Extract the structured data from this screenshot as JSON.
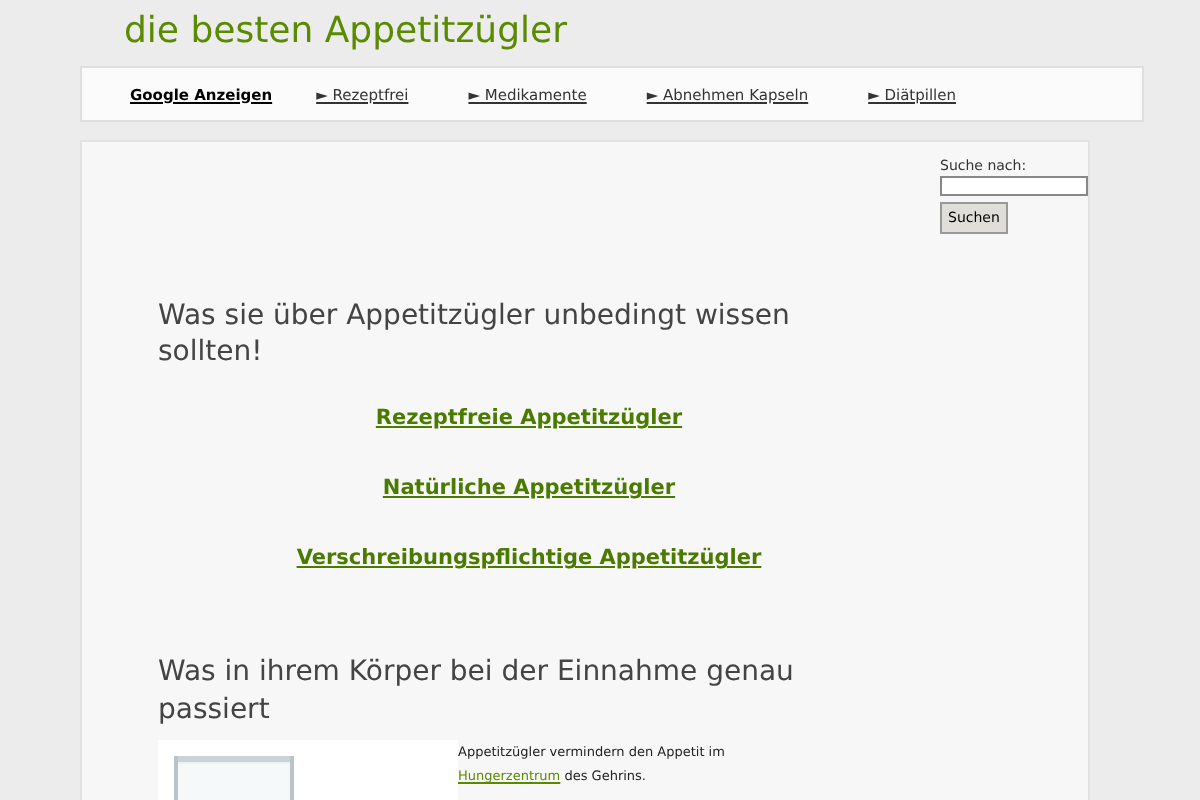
{
  "site_title": "die besten Appetitzügler",
  "nav": {
    "label": "Google Anzeigen",
    "links": [
      {
        "arrow": "►",
        "text": "Rezeptfrei"
      },
      {
        "arrow": "►",
        "text": "Medikamente"
      },
      {
        "arrow": "►",
        "text": "Abnehmen Kapseln"
      },
      {
        "arrow": "►",
        "text": "Diätpillen"
      }
    ]
  },
  "heading": "Was sie über Appetitzügler unbedingt wissen sollten!",
  "links": [
    "Rezeptfreie Appetitzügler",
    "Natürliche Appetitzügler",
    "Verschreibungspflichtige Appetitzügler"
  ],
  "section_heading": " Was in ihrem Körper bei der Einnahme genau passiert",
  "image": {
    "kind": "picture"
  },
  "paragraph": {
    "before": "Appetitzügler vermindern den Appetit im ",
    "link": "Hungerzentrum",
    "after": " des Gehrins."
  },
  "search": {
    "label": "Suche nach:",
    "button": "Suchen"
  }
}
